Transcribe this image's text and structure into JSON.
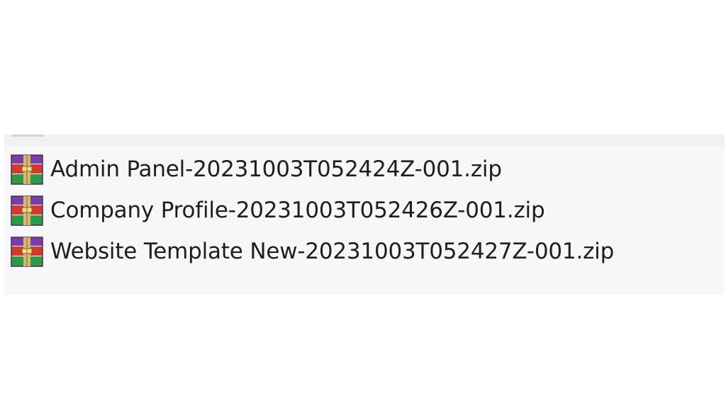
{
  "files": [
    {
      "name": "Admin Panel-20231003T052424Z-001.zip",
      "icon": "winrar-archive-icon"
    },
    {
      "name": "Company Profile-20231003T052426Z-001.zip",
      "icon": "winrar-archive-icon"
    },
    {
      "name": "Website Template New-20231003T052427Z-001.zip",
      "icon": "winrar-archive-icon"
    }
  ]
}
